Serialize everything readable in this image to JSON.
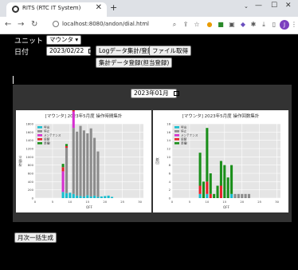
{
  "browser": {
    "tab_title": "RITS (RTC IT System)",
    "tab_close": "✕",
    "new_tab": "+",
    "url": "localhost:8080/andon/dial.html",
    "avatar": "J",
    "win_min": "—",
    "win_max": "☐",
    "win_close": "✕"
  },
  "form": {
    "unit_label": "ユニット",
    "unit_value": "マウンタ",
    "date_label": "日付",
    "date_value": "2023/02/22",
    "log_button": "Logデータ集計/登録",
    "file_button": "ファイル取得",
    "agg_button": "集計データ登録(担当登録)"
  },
  "month_picker": {
    "value": "2023年01月"
  },
  "footer": {
    "monthly_button": "月次一括生成"
  },
  "charts": [
    {
      "title": "[マウンタ] 2023年5月度 操作時間集計",
      "xlabel": "OFF",
      "ylabel": "時間(s)",
      "legend": [
        {
          "name": "呼出",
          "color": "#17becf"
        },
        {
          "name": "停止",
          "color": "#8c8c8c"
        },
        {
          "name": "メンテナンス",
          "color": "#d62fd0"
        },
        {
          "name": "段替",
          "color": "#e8222a"
        },
        {
          "name": "準備!",
          "color": "#1a8f1a"
        }
      ],
      "yticks": [
        "1800",
        "1600",
        "1400",
        "1200",
        "1000",
        "800",
        "600",
        "400",
        "200",
        "0"
      ],
      "xticks": [
        "0",
        "5",
        "10",
        "15",
        "20",
        "25",
        "30"
      ]
    },
    {
      "title": "[マウンタ] 2023年5月度 操作回数集計",
      "xlabel": "OFF",
      "ylabel": "回数",
      "legend": [
        {
          "name": "呼出",
          "color": "#17becf"
        },
        {
          "name": "停止",
          "color": "#8c8c8c"
        },
        {
          "name": "メンテナンス",
          "color": "#d62fd0"
        },
        {
          "name": "段替",
          "color": "#e8222a"
        },
        {
          "name": "準備!",
          "color": "#1a8f1a"
        }
      ],
      "yticks": [
        "18",
        "16",
        "14",
        "12",
        "10",
        "8",
        "6",
        "4",
        "2",
        "0"
      ],
      "xticks": [
        "0",
        "5",
        "10",
        "15",
        "20",
        "25",
        "30"
      ]
    }
  ],
  "chart_data": [
    {
      "type": "bar",
      "stacked": true,
      "title": "[マウンタ] 2023年5月度 操作時間集計",
      "xlabel": "OFF",
      "ylabel": "時間(s)",
      "ylim": [
        0,
        1800
      ],
      "xlim": [
        0,
        31
      ],
      "x": [
        8,
        9,
        10,
        11,
        12,
        13,
        14,
        15,
        16,
        17,
        18,
        19,
        20,
        21,
        22
      ],
      "series": [
        {
          "name": "呼出",
          "values": [
            150,
            120,
            130,
            100,
            60,
            50,
            40,
            70,
            40,
            60,
            30,
            40,
            50,
            60,
            30
          ]
        },
        {
          "name": "停止",
          "values": [
            0,
            1100,
            0,
            1600,
            1550,
            1700,
            1600,
            1500,
            1650,
            1400,
            1100,
            0,
            0,
            0,
            0
          ]
        },
        {
          "name": "メンテナンス",
          "values": [
            500,
            0,
            0,
            400,
            0,
            0,
            0,
            0,
            0,
            0,
            0,
            0,
            0,
            0,
            0
          ]
        },
        {
          "name": "段替",
          "values": [
            100,
            40,
            0,
            80,
            0,
            0,
            0,
            0,
            0,
            0,
            0,
            0,
            0,
            0,
            0
          ]
        },
        {
          "name": "準備!",
          "values": [
            80,
            50,
            0,
            60,
            0,
            0,
            0,
            0,
            0,
            0,
            0,
            0,
            0,
            0,
            0
          ]
        }
      ]
    },
    {
      "type": "bar",
      "stacked": true,
      "title": "[マウンタ] 2023年5月度 操作回数集計",
      "xlabel": "OFF",
      "ylabel": "回数",
      "ylim": [
        0,
        18
      ],
      "xlim": [
        0,
        31
      ],
      "x": [
        7,
        8,
        9,
        10,
        11,
        12,
        13,
        14,
        15,
        16,
        17,
        18,
        19,
        20,
        21,
        22
      ],
      "series": [
        {
          "name": "呼出",
          "values": [
            0,
            1,
            0,
            1,
            0,
            0,
            0,
            0,
            0,
            0,
            1,
            0,
            0,
            0,
            0,
            0
          ]
        },
        {
          "name": "停止",
          "values": [
            0,
            0,
            0,
            0,
            0,
            0,
            0,
            0,
            0,
            0,
            0,
            1,
            1,
            1,
            1,
            1
          ]
        },
        {
          "name": "メンテナンス",
          "values": [
            0,
            0,
            0,
            0,
            0,
            0,
            0,
            0,
            0,
            0,
            0,
            0,
            0,
            0,
            0,
            0
          ]
        },
        {
          "name": "段替",
          "values": [
            0,
            2,
            0,
            3,
            1,
            0,
            0,
            3,
            0,
            0,
            0,
            0,
            0,
            0,
            0,
            0
          ]
        },
        {
          "name": "準備!",
          "values": [
            0,
            8,
            4,
            13,
            5,
            1,
            3,
            6,
            8,
            5,
            7,
            0,
            0,
            0,
            0,
            0
          ]
        }
      ]
    }
  ]
}
